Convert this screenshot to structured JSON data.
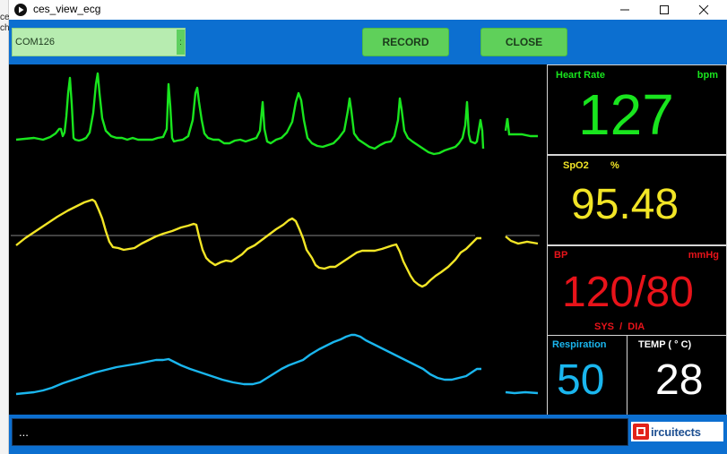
{
  "window": {
    "title": "ces_view_ecg"
  },
  "desktop": {
    "fragments": [
      "ce",
      "ch"
    ]
  },
  "toolbar": {
    "port": {
      "value": "COM126",
      "arrow": ":"
    },
    "record_label": "RECORD",
    "close_label": "CLOSE"
  },
  "vitals": {
    "heart_rate": {
      "label": "Heart Rate",
      "unit": "bpm",
      "value": "127"
    },
    "spo2": {
      "label": "SpO2",
      "unit": "%",
      "value": "95.48"
    },
    "bp": {
      "label": "BP",
      "unit": "mmHg",
      "value": "120/80",
      "sub": "SYS  /  DIA"
    },
    "respiration": {
      "label": "Respiration",
      "value": "50"
    },
    "temp": {
      "label": "TEMP ( ° C)",
      "value": "28"
    }
  },
  "status": {
    "log": "..."
  },
  "brand": {
    "logo_text": "ircuitects"
  },
  "colors": {
    "ecg": "#19e51e",
    "pleth": "#f2e526",
    "resp": "#1ab6ee",
    "bp": "#e8131a",
    "toolbar": "#0c6fd0"
  }
}
